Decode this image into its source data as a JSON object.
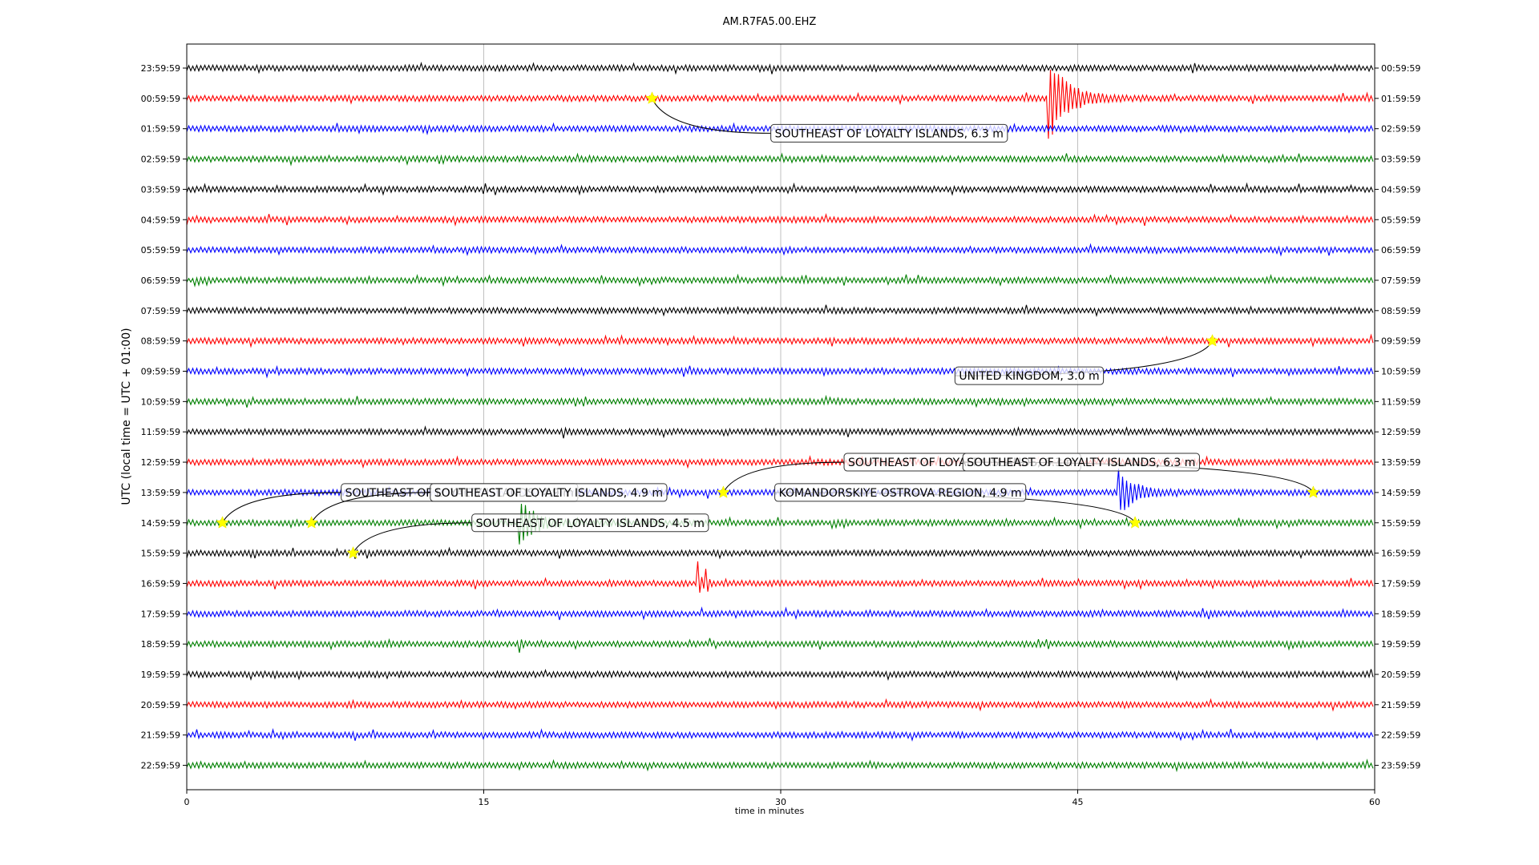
{
  "chart_data": {
    "type": "line",
    "title": "AM.R7FA5.00.EHZ",
    "xlabel": "time in minutes",
    "ylabel": "UTC (local time = UTC + 01:00)",
    "xlim": [
      0,
      60
    ],
    "x_ticks": [
      "0",
      "15",
      "30",
      "45",
      "60"
    ],
    "x_tick_values": [
      0,
      15,
      30,
      45,
      60
    ],
    "grid": "vertical",
    "trace_colors": [
      "#000000",
      "#ff0000",
      "#0000ff",
      "#008000"
    ],
    "left_labels": [
      "23:59:59",
      "00:59:59",
      "01:59:59",
      "02:59:59",
      "03:59:59",
      "04:59:59",
      "05:59:59",
      "06:59:59",
      "07:59:59",
      "08:59:59",
      "09:59:59",
      "10:59:59",
      "11:59:59",
      "12:59:59",
      "13:59:59",
      "14:59:59",
      "15:59:59",
      "16:59:59",
      "17:59:59",
      "18:59:59",
      "19:59:59",
      "20:59:59",
      "21:59:59",
      "22:59:59"
    ],
    "right_labels": [
      "00:59:59",
      "01:59:59",
      "02:59:59",
      "03:59:59",
      "04:59:59",
      "05:59:59",
      "06:59:59",
      "07:59:59",
      "08:59:59",
      "09:59:59",
      "10:59:59",
      "11:59:59",
      "12:59:59",
      "13:59:59",
      "14:59:59",
      "15:59:59",
      "16:59:59",
      "17:59:59",
      "18:59:59",
      "19:59:59",
      "20:59:59",
      "21:59:59",
      "22:59:59",
      "23:59:59"
    ],
    "signal_events": [
      {
        "trace": 1,
        "minute": 43.5,
        "amplitude": 1.6,
        "decay": 0.9
      },
      {
        "trace": 14,
        "minute": 47.1,
        "amplitude": 0.9,
        "decay": 0.7
      },
      {
        "trace": 15,
        "minute": 16.8,
        "amplitude": 1.0,
        "decay": 0.7
      },
      {
        "trace": 17,
        "minute": 25.8,
        "amplitude": 0.8,
        "decay": 0.15
      },
      {
        "trace": 17,
        "minute": 26.2,
        "amplitude": 0.7,
        "decay": 0.1
      },
      {
        "trace": 19,
        "minute": 16.8,
        "amplitude": 0.25,
        "decay": 0.1
      },
      {
        "trace": 12,
        "minute": 19.0,
        "amplitude": 0.2,
        "decay": 0.1
      }
    ],
    "quakes": [
      {
        "trace": 1,
        "minute": 23.5,
        "label": "SOUTHEAST OF LOYALTY ISLANDS, 6.3 m",
        "label_trace": 2.15,
        "label_minute": 29.5
      },
      {
        "trace": 9,
        "minute": 51.8,
        "label": "UNITED KINGDOM, 3.0 m",
        "label_trace": 10.15,
        "label_minute": 38.8
      },
      {
        "trace": 15,
        "minute": 1.8,
        "label": "SOUTHEAST OF LOYALTY ISLANDS, 4.9 m",
        "label_trace": 14.0,
        "label_minute": 7.8
      },
      {
        "trace": 15,
        "minute": 6.3,
        "label": "SOUTHEAST OF LOYALTY ISLANDS, 4.9 m",
        "label_trace": 14.0,
        "label_minute": 12.3
      },
      {
        "trace": 16,
        "minute": 8.4,
        "label": "SOUTHEAST OF LOYALTY ISLANDS, 4.5 m",
        "label_trace": 15.0,
        "label_minute": 14.4
      },
      {
        "trace": 14,
        "minute": 27.1,
        "label": "SOUTHEAST OF LOYALTY ISLANDS, 6.3 m",
        "label_trace": 13.0,
        "label_minute": 33.2
      },
      {
        "trace": 14,
        "minute": 56.9,
        "label": "SOUTHEAST OF LOYALTY ISLANDS, 6.3 m",
        "label_trace": 13.0,
        "label_minute": 39.2
      },
      {
        "trace": 15,
        "minute": 47.9,
        "label": "KOMANDORSKIYE OSTROVA REGION, 4.9 m",
        "label_trace": 14.0,
        "label_minute": 29.7
      }
    ]
  }
}
